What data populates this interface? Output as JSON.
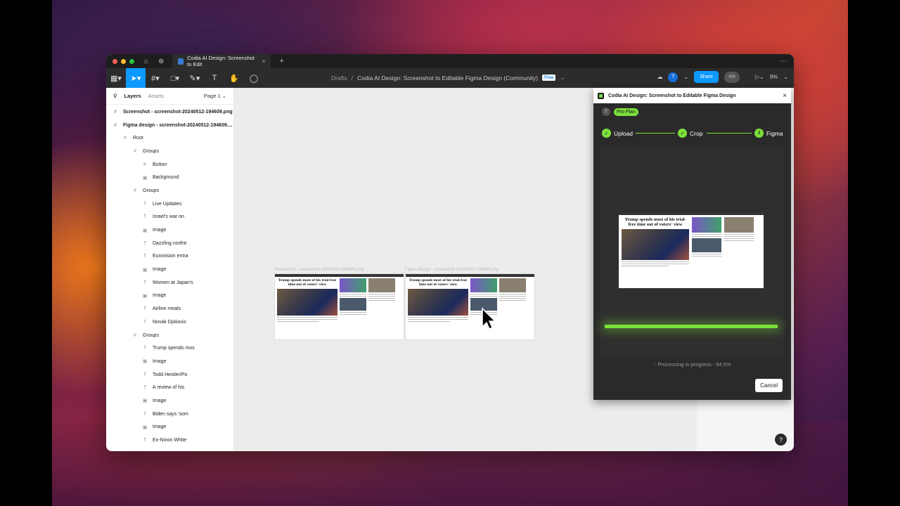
{
  "tab": {
    "title": "Codia AI Design: Screenshot to Edit",
    "close": "×"
  },
  "toolbar": {
    "crumb_root": "Drafts",
    "crumb_sep": "/",
    "file_name": "Codia AI Design: Screenshot to Editable Figma Design (Community)",
    "free_badge": "Free",
    "share_label": "Share",
    "avatar_initial": "T",
    "zoom": "9%"
  },
  "layers_panel": {
    "tab_layers": "Layers",
    "tab_assets": "Assets",
    "page": "Page 1",
    "items": [
      {
        "label": "Screenshot - screenshot-20240512-194609.png",
        "icon": "#",
        "indent": 0,
        "bold": true
      },
      {
        "label": "Figma design - screenshot-20240512-194609....",
        "icon": "#",
        "indent": 0,
        "bold": true
      },
      {
        "label": "Root",
        "icon": "#",
        "indent": 1,
        "bold": false
      },
      {
        "label": "Groups",
        "icon": "#",
        "indent": 2,
        "bold": false
      },
      {
        "label": "Button",
        "icon": "#",
        "indent": 3,
        "bold": false
      },
      {
        "label": "Background",
        "icon": "▣",
        "indent": 3,
        "bold": false
      },
      {
        "label": "Groups",
        "icon": "#",
        "indent": 2,
        "bold": false
      },
      {
        "label": "Live Updates:",
        "icon": "T",
        "indent": 3,
        "bold": false
      },
      {
        "label": "Israel's war on",
        "icon": "T",
        "indent": 3,
        "bold": false
      },
      {
        "label": "Image",
        "icon": "▣",
        "indent": 3,
        "bold": false
      },
      {
        "label": "Dazzling northe",
        "icon": "T",
        "indent": 3,
        "bold": false
      },
      {
        "label": "Eurovision entra",
        "icon": "T",
        "indent": 3,
        "bold": false
      },
      {
        "label": "Image",
        "icon": "▣",
        "indent": 3,
        "bold": false
      },
      {
        "label": "Women at Japan's",
        "icon": "T",
        "indent": 3,
        "bold": false
      },
      {
        "label": "Image",
        "icon": "▣",
        "indent": 3,
        "bold": false
      },
      {
        "label": "Airline meals",
        "icon": "T",
        "indent": 3,
        "bold": false
      },
      {
        "label": "Novak Djokovic",
        "icon": "T",
        "indent": 3,
        "bold": false
      },
      {
        "label": "Groups",
        "icon": "#",
        "indent": 2,
        "bold": false
      },
      {
        "label": "Trump spends mos",
        "icon": "T",
        "indent": 3,
        "bold": false
      },
      {
        "label": "Image",
        "icon": "▣",
        "indent": 3,
        "bold": false
      },
      {
        "label": "Todd Heisler/Po",
        "icon": "T",
        "indent": 3,
        "bold": false
      },
      {
        "label": "A review of his",
        "icon": "T",
        "indent": 3,
        "bold": false
      },
      {
        "label": "Image",
        "icon": "▣",
        "indent": 3,
        "bold": false
      },
      {
        "label": "Biden says 'som",
        "icon": "T",
        "indent": 3,
        "bold": false
      },
      {
        "label": "Image",
        "icon": "▣",
        "indent": 3,
        "bold": false
      },
      {
        "label": "Ex-Nixon White",
        "icon": "T",
        "indent": 3,
        "bold": false
      }
    ]
  },
  "canvas": {
    "frame1_label": "Screenshot - screenshot-20240512-194609.png",
    "frame2_label": "Figma design - screenshot-20240512-194609.png",
    "headline": "Trump spends most of his trial-free time out of voters' view"
  },
  "plugin": {
    "title": "Codia AI Design: Screenshot to Editable Figma Design",
    "close": "×",
    "user_initial": "T",
    "plan": "Pro Plan",
    "steps": [
      {
        "label": "Upload",
        "mark": "✓"
      },
      {
        "label": "Crop",
        "mark": "✓"
      },
      {
        "label": "Figma",
        "mark": "3"
      }
    ],
    "progress": 0.545,
    "status": "Processing in progress - 54.5%",
    "cancel_label": "Cancel"
  },
  "help": "?"
}
